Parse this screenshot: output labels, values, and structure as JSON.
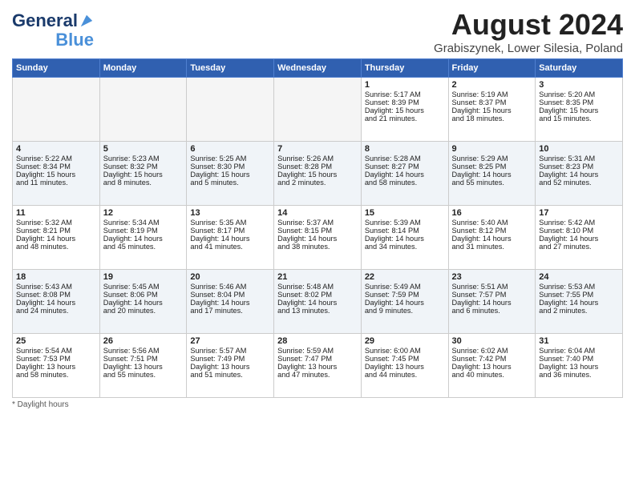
{
  "header": {
    "logo_line1": "General",
    "logo_line2": "Blue",
    "month_year": "August 2024",
    "location": "Grabiszynek, Lower Silesia, Poland"
  },
  "days_of_week": [
    "Sunday",
    "Monday",
    "Tuesday",
    "Wednesday",
    "Thursday",
    "Friday",
    "Saturday"
  ],
  "footer": {
    "note": "Daylight hours"
  },
  "weeks": [
    [
      {
        "day": "",
        "info": ""
      },
      {
        "day": "",
        "info": ""
      },
      {
        "day": "",
        "info": ""
      },
      {
        "day": "",
        "info": ""
      },
      {
        "day": "1",
        "info": "Sunrise: 5:17 AM\nSunset: 8:39 PM\nDaylight: 15 hours\nand 21 minutes."
      },
      {
        "day": "2",
        "info": "Sunrise: 5:19 AM\nSunset: 8:37 PM\nDaylight: 15 hours\nand 18 minutes."
      },
      {
        "day": "3",
        "info": "Sunrise: 5:20 AM\nSunset: 8:35 PM\nDaylight: 15 hours\nand 15 minutes."
      }
    ],
    [
      {
        "day": "4",
        "info": "Sunrise: 5:22 AM\nSunset: 8:34 PM\nDaylight: 15 hours\nand 11 minutes."
      },
      {
        "day": "5",
        "info": "Sunrise: 5:23 AM\nSunset: 8:32 PM\nDaylight: 15 hours\nand 8 minutes."
      },
      {
        "day": "6",
        "info": "Sunrise: 5:25 AM\nSunset: 8:30 PM\nDaylight: 15 hours\nand 5 minutes."
      },
      {
        "day": "7",
        "info": "Sunrise: 5:26 AM\nSunset: 8:28 PM\nDaylight: 15 hours\nand 2 minutes."
      },
      {
        "day": "8",
        "info": "Sunrise: 5:28 AM\nSunset: 8:27 PM\nDaylight: 14 hours\nand 58 minutes."
      },
      {
        "day": "9",
        "info": "Sunrise: 5:29 AM\nSunset: 8:25 PM\nDaylight: 14 hours\nand 55 minutes."
      },
      {
        "day": "10",
        "info": "Sunrise: 5:31 AM\nSunset: 8:23 PM\nDaylight: 14 hours\nand 52 minutes."
      }
    ],
    [
      {
        "day": "11",
        "info": "Sunrise: 5:32 AM\nSunset: 8:21 PM\nDaylight: 14 hours\nand 48 minutes."
      },
      {
        "day": "12",
        "info": "Sunrise: 5:34 AM\nSunset: 8:19 PM\nDaylight: 14 hours\nand 45 minutes."
      },
      {
        "day": "13",
        "info": "Sunrise: 5:35 AM\nSunset: 8:17 PM\nDaylight: 14 hours\nand 41 minutes."
      },
      {
        "day": "14",
        "info": "Sunrise: 5:37 AM\nSunset: 8:15 PM\nDaylight: 14 hours\nand 38 minutes."
      },
      {
        "day": "15",
        "info": "Sunrise: 5:39 AM\nSunset: 8:14 PM\nDaylight: 14 hours\nand 34 minutes."
      },
      {
        "day": "16",
        "info": "Sunrise: 5:40 AM\nSunset: 8:12 PM\nDaylight: 14 hours\nand 31 minutes."
      },
      {
        "day": "17",
        "info": "Sunrise: 5:42 AM\nSunset: 8:10 PM\nDaylight: 14 hours\nand 27 minutes."
      }
    ],
    [
      {
        "day": "18",
        "info": "Sunrise: 5:43 AM\nSunset: 8:08 PM\nDaylight: 14 hours\nand 24 minutes."
      },
      {
        "day": "19",
        "info": "Sunrise: 5:45 AM\nSunset: 8:06 PM\nDaylight: 14 hours\nand 20 minutes."
      },
      {
        "day": "20",
        "info": "Sunrise: 5:46 AM\nSunset: 8:04 PM\nDaylight: 14 hours\nand 17 minutes."
      },
      {
        "day": "21",
        "info": "Sunrise: 5:48 AM\nSunset: 8:02 PM\nDaylight: 14 hours\nand 13 minutes."
      },
      {
        "day": "22",
        "info": "Sunrise: 5:49 AM\nSunset: 7:59 PM\nDaylight: 14 hours\nand 9 minutes."
      },
      {
        "day": "23",
        "info": "Sunrise: 5:51 AM\nSunset: 7:57 PM\nDaylight: 14 hours\nand 6 minutes."
      },
      {
        "day": "24",
        "info": "Sunrise: 5:53 AM\nSunset: 7:55 PM\nDaylight: 14 hours\nand 2 minutes."
      }
    ],
    [
      {
        "day": "25",
        "info": "Sunrise: 5:54 AM\nSunset: 7:53 PM\nDaylight: 13 hours\nand 58 minutes."
      },
      {
        "day": "26",
        "info": "Sunrise: 5:56 AM\nSunset: 7:51 PM\nDaylight: 13 hours\nand 55 minutes."
      },
      {
        "day": "27",
        "info": "Sunrise: 5:57 AM\nSunset: 7:49 PM\nDaylight: 13 hours\nand 51 minutes."
      },
      {
        "day": "28",
        "info": "Sunrise: 5:59 AM\nSunset: 7:47 PM\nDaylight: 13 hours\nand 47 minutes."
      },
      {
        "day": "29",
        "info": "Sunrise: 6:00 AM\nSunset: 7:45 PM\nDaylight: 13 hours\nand 44 minutes."
      },
      {
        "day": "30",
        "info": "Sunrise: 6:02 AM\nSunset: 7:42 PM\nDaylight: 13 hours\nand 40 minutes."
      },
      {
        "day": "31",
        "info": "Sunrise: 6:04 AM\nSunset: 7:40 PM\nDaylight: 13 hours\nand 36 minutes."
      }
    ]
  ]
}
